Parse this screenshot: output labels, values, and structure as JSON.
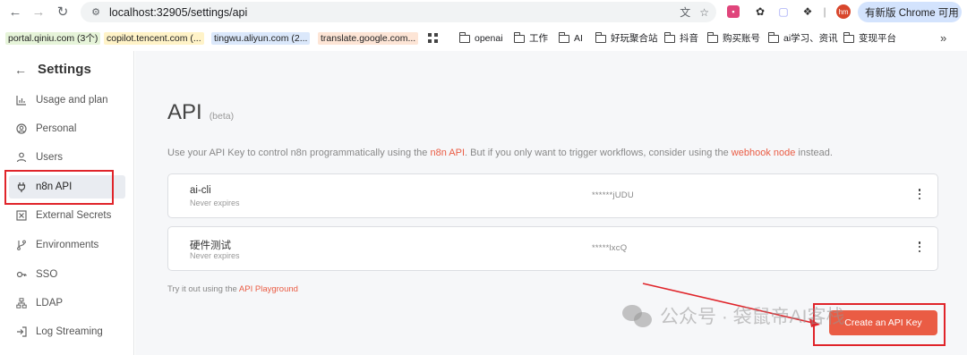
{
  "browser": {
    "url": "localhost:32905/settings/api",
    "update_label": "有新版 Chrome 可用",
    "avatar_text": "hm",
    "bookmarks": [
      {
        "label": "portal.qiniu.com (3个)",
        "color": "#e6f4d9"
      },
      {
        "label": "copilot.tencent.com (...",
        "color": "#fff3c8"
      },
      {
        "label": "tingwu.aliyun.com (2...",
        "color": "#dbe8fb"
      },
      {
        "label": "translate.google.com...",
        "color": "#fde5d6"
      }
    ],
    "folders": [
      "openai",
      "工作",
      "AI",
      "好玩聚合站",
      "抖音",
      "购买账号",
      "ai学习、资讯",
      "变现平台"
    ],
    "more_label": "»"
  },
  "sidebar": {
    "title": "Settings",
    "back_icon": "arrow-left-icon",
    "items": [
      {
        "label": "Usage and plan",
        "icon": "bar-chart-icon"
      },
      {
        "label": "Personal",
        "icon": "user-circle-icon"
      },
      {
        "label": "Users",
        "icon": "user-icon"
      },
      {
        "label": "n8n API",
        "icon": "plug-icon",
        "active": true
      },
      {
        "label": "External Secrets",
        "icon": "square-x-icon"
      },
      {
        "label": "Environments",
        "icon": "git-branch-icon"
      },
      {
        "label": "SSO",
        "icon": "key-icon"
      },
      {
        "label": "LDAP",
        "icon": "network-icon"
      },
      {
        "label": "Log Streaming",
        "icon": "sign-in-icon"
      }
    ]
  },
  "main": {
    "title": "API",
    "beta": "(beta)",
    "description": {
      "prefix": "Use your API Key to control n8n programmatically using the ",
      "link1": "n8n API",
      "middle": ". But if you only want to trigger workflows, consider using the ",
      "link2": "webhook node",
      "suffix": " instead."
    },
    "keys": [
      {
        "name": "ai-cli",
        "expiry": "Never expires",
        "masked": "******jUDU"
      },
      {
        "name": "硬件测试",
        "expiry": "Never expires",
        "masked": "*****lxcQ"
      }
    ],
    "playground": {
      "prefix": "Try it out using the ",
      "link": "API Playground"
    },
    "create_button": "Create an API Key",
    "accent_color": "#ea5c44"
  },
  "annotations": {
    "watermark_text": "公众号 · 袋鼠帝AI客栈"
  }
}
